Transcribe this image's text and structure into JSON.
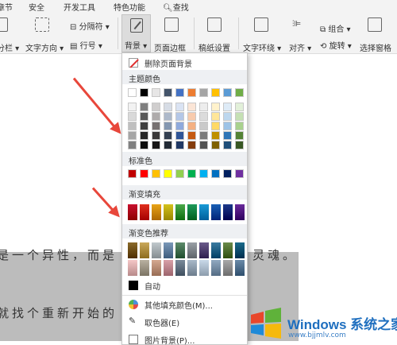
{
  "menu_tabs": [
    "章节",
    "安全",
    "开发工具",
    "特色功能",
    "查找"
  ],
  "ribbon": {
    "split_columns": "分栏",
    "text_direction": "文字方向",
    "separator": "分隔符",
    "line_number": "行号",
    "background": "背景",
    "page_border": "页面边框",
    "paper_setting": "稿纸设置",
    "text_wrap": "文字环绕",
    "align": "对齐",
    "group": "组合",
    "rotate": "旋转",
    "selection_pane": "选择窗格"
  },
  "document": {
    "line1_left": "是一个异性，而是",
    "line1_right": "灵魂。",
    "line2": "就找个重新开始的"
  },
  "dropdown": {
    "remove_background": "删除页面背景",
    "theme_colors_label": "主题颜色",
    "standard_colors_label": "标准色",
    "gradient_fill_label": "渐变填充",
    "gradient_recommend_label": "渐变色推荐",
    "auto": "自动",
    "more_colors": "其他填充颜色(M)...",
    "eyedropper": "取色器(E)",
    "picture_background": "图片背景(P)..."
  },
  "theme_colors": {
    "top": [
      "#ffffff",
      "#000000",
      "#e7e6e6",
      "#44546a",
      "#4472c4",
      "#ed7d31",
      "#a5a5a5",
      "#ffc000",
      "#5b9bd5",
      "#70ad47"
    ],
    "shades": [
      [
        "#f2f2f2",
        "#7f7f7f",
        "#d0cece",
        "#d6dce5",
        "#dae3f3",
        "#fbe5d6",
        "#ededed",
        "#fff2cc",
        "#deebf7",
        "#e2f0d9"
      ],
      [
        "#d9d9d9",
        "#595959",
        "#aeabab",
        "#adb9ca",
        "#b4c7e7",
        "#f8cbad",
        "#dbdbdb",
        "#ffe699",
        "#bdd7ee",
        "#c5e0b4"
      ],
      [
        "#bfbfbf",
        "#404040",
        "#767171",
        "#8497b0",
        "#8faadc",
        "#f4b183",
        "#c9c9c9",
        "#ffd966",
        "#9dc3e6",
        "#a9d18e"
      ],
      [
        "#a6a6a6",
        "#262626",
        "#3a3838",
        "#333f50",
        "#2f5597",
        "#c55a11",
        "#7b7b7b",
        "#bf9000",
        "#2e75b6",
        "#548235"
      ],
      [
        "#808080",
        "#0d0d0d",
        "#171616",
        "#222a35",
        "#203864",
        "#843c0c",
        "#525252",
        "#7f6000",
        "#1f4e79",
        "#385723"
      ]
    ]
  },
  "standard_colors": [
    "#c00000",
    "#ff0000",
    "#ffc000",
    "#ffff00",
    "#92d050",
    "#00b050",
    "#00b0f0",
    "#0070c0",
    "#002060",
    "#7030a0"
  ],
  "gradient_fill": [
    "#c8102e",
    "#e0301e",
    "#e8a317",
    "#d4c21c",
    "#4aa84a",
    "#1f9a5a",
    "#1a9ad6",
    "#1a5fb4",
    "#1d3a8a",
    "#6a2a9a"
  ],
  "gradient_recommend": [
    [
      "#8a6a2a",
      "#c9a85a",
      "#c0c8cc",
      "#7a98b8",
      "#5c8a6a",
      "#9aa0a6",
      "#6a5a8a",
      "#3a7aa0",
      "#6a8a4a",
      "#1a6a8a"
    ],
    [
      "#f4c6c6",
      "#b8b0a0",
      "#d4a890",
      "#d8a0a8",
      "#7a8a9a",
      "#a8b8c8",
      "#c8d8e8",
      "#90a8c0",
      "#a8a8a8",
      "#6a8aa8"
    ]
  ],
  "watermark": {
    "title": "Windows 系统之家",
    "url": "www.bjjmlv.com"
  }
}
